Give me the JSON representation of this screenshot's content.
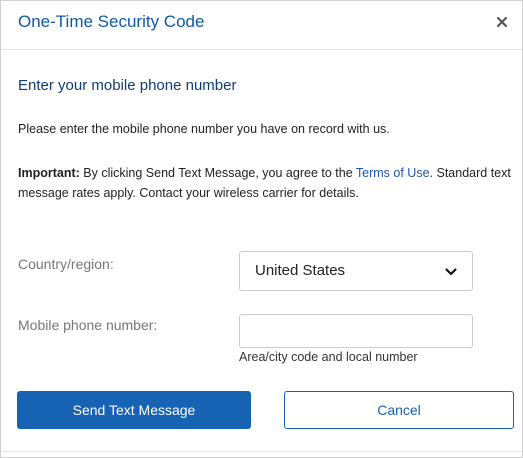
{
  "dialog": {
    "title": "One-Time Security Code",
    "close_icon": "close-icon"
  },
  "content": {
    "subtitle": "Enter your mobile phone number",
    "intro": "Please enter the mobile phone number you have on record with us.",
    "important": {
      "label": "Important:",
      "text_before_link": " By clicking Send Text Message, you agree to the ",
      "link_text": "Terms of Use",
      "text_after_link": ". Standard text message rates apply. Contact your wireless carrier for details."
    }
  },
  "form": {
    "country": {
      "label": "Country/region:",
      "selected": "United States",
      "icon": "chevron-down-icon"
    },
    "phone": {
      "label": "Mobile phone number:",
      "value": "",
      "placeholder": "",
      "hint": "Area/city code and local number"
    }
  },
  "actions": {
    "primary_label": "Send Text Message",
    "secondary_label": "Cancel"
  },
  "colors": {
    "title": "#0f5aa8",
    "subtitle": "#0f3d73",
    "primary_button": "#1662b3",
    "link": "#1d55b5"
  }
}
